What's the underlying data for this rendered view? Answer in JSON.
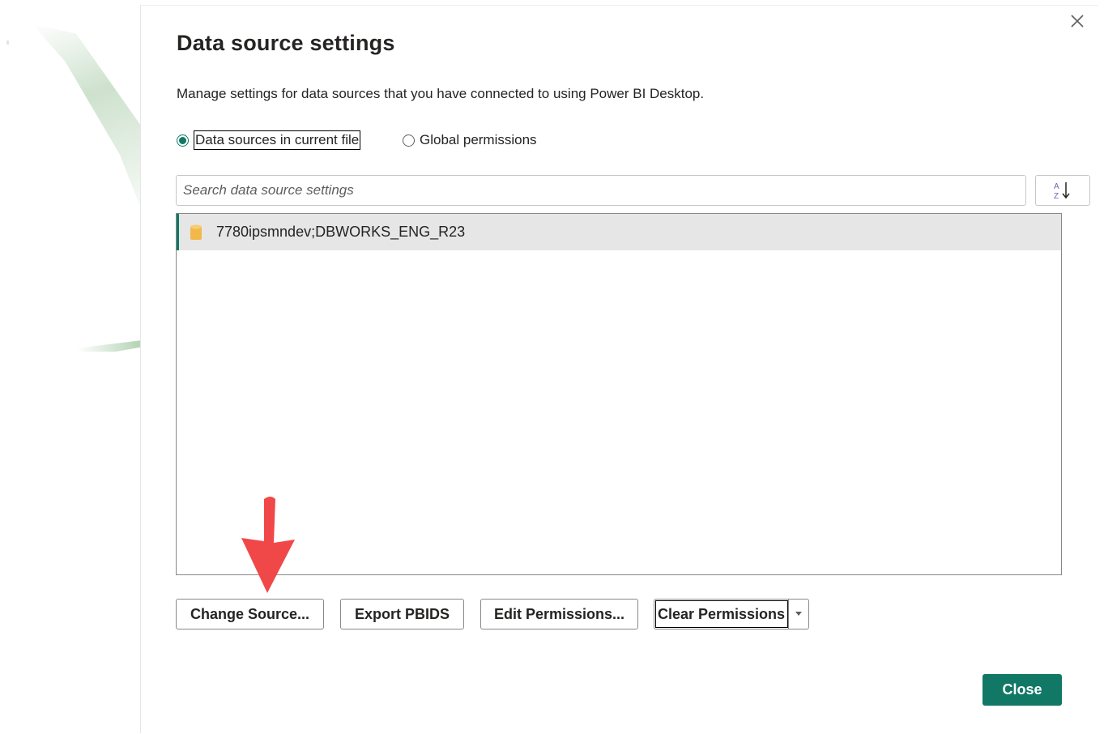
{
  "dialog": {
    "title": "Data source settings",
    "description": "Manage settings for data sources that you have connected to using Power BI Desktop.",
    "close_icon": "close-icon"
  },
  "scope": {
    "options": [
      {
        "label": "Data sources in current file",
        "selected": true
      },
      {
        "label": "Global permissions",
        "selected": false
      }
    ]
  },
  "search": {
    "placeholder": "Search data source settings",
    "value": ""
  },
  "sort": {
    "icon": "sort-az-icon"
  },
  "sources": {
    "items": [
      {
        "label": "7780ipsmndev;DBWORKS_ENG_R23",
        "icon": "database-icon",
        "selected": true
      }
    ]
  },
  "actions": {
    "change_source": "Change Source...",
    "export_pbids": "Export PBIDS",
    "edit_permissions": "Edit Permissions...",
    "clear_permissions": "Clear Permissions",
    "close": "Close"
  },
  "colors": {
    "accent": "#117865",
    "annotation_arrow": "#f04848"
  }
}
